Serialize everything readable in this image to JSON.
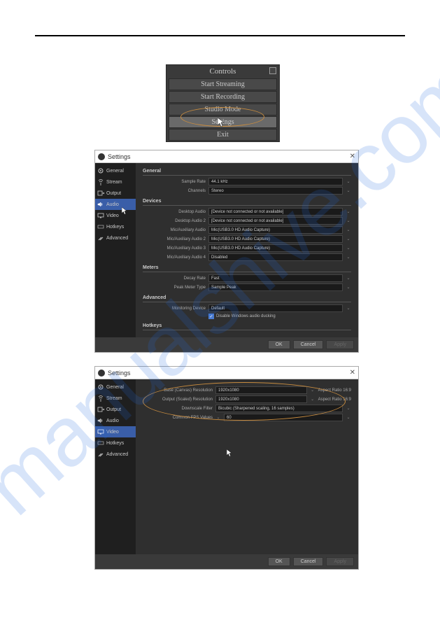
{
  "watermark": "manualshive.com",
  "controls": {
    "title": "Controls",
    "items": [
      "Start Streaming",
      "Start Recording",
      "Studio Mode",
      "Settings",
      "Exit"
    ],
    "highlighted_index": 3
  },
  "settings1": {
    "window_title": "Settings",
    "sidebar": [
      {
        "icon": "gear",
        "label": "General"
      },
      {
        "icon": "antenna",
        "label": "Stream"
      },
      {
        "icon": "out",
        "label": "Output"
      },
      {
        "icon": "speaker",
        "label": "Audio"
      },
      {
        "icon": "monitor",
        "label": "Video"
      },
      {
        "icon": "keyboard",
        "label": "Hotkeys"
      },
      {
        "icon": "tools",
        "label": "Advanced"
      }
    ],
    "sidebar_selected": 3,
    "sections": {
      "general": {
        "title": "General",
        "rows": [
          {
            "label": "Sample Rate",
            "value": "44.1 kHz"
          },
          {
            "label": "Channels",
            "value": "Stereo"
          }
        ]
      },
      "devices": {
        "title": "Devices",
        "rows": [
          {
            "label": "Desktop Audio",
            "value": "[Device not connected or not available]"
          },
          {
            "label": "Desktop Audio 2",
            "value": "[Device not connected or not available]"
          },
          {
            "label": "Mic/Auxiliary Audio",
            "value": "Mic(USB3.0 HD Audio Capture)"
          },
          {
            "label": "Mic/Auxiliary Audio 2",
            "value": "Mic(USB3.0 HD Audio Capture)"
          },
          {
            "label": "Mic/Auxiliary Audio 3",
            "value": "Mic(USB3.0 HD Audio Capture)"
          },
          {
            "label": "Mic/Auxiliary Audio 4",
            "value": "Disabled"
          }
        ]
      },
      "meters": {
        "title": "Meters",
        "rows": [
          {
            "label": "Decay Rate",
            "value": "Fast"
          },
          {
            "label": "Peak Meter Type",
            "value": "Sample Peak"
          }
        ]
      },
      "advanced": {
        "title": "Advanced",
        "rows": [
          {
            "label": "Monitoring Device",
            "value": "Default"
          }
        ],
        "checkbox": "Disable Windows audio ducking"
      },
      "hotkeys": {
        "title": "Hotkeys"
      }
    },
    "buttons": {
      "ok": "OK",
      "cancel": "Cancel",
      "apply": "Apply"
    }
  },
  "settings2": {
    "window_title": "Settings",
    "sidebar": [
      {
        "icon": "gear",
        "label": "General"
      },
      {
        "icon": "antenna",
        "label": "Stream"
      },
      {
        "icon": "out",
        "label": "Output"
      },
      {
        "icon": "speaker",
        "label": "Audio"
      },
      {
        "icon": "monitor",
        "label": "Video"
      },
      {
        "icon": "keyboard",
        "label": "Hotkeys"
      },
      {
        "icon": "tools",
        "label": "Advanced"
      }
    ],
    "sidebar_selected": 4,
    "rows": [
      {
        "label": "Base (Canvas) Resolution",
        "value": "1920x1080",
        "aspect": "Aspect Ratio 16:9"
      },
      {
        "label": "Output (Scaled) Resolution",
        "value": "1920x1080",
        "aspect": "Aspect Ratio 16:9"
      },
      {
        "label": "Downscale Filter",
        "value": "Bicubic (Sharpened scaling, 16 samples)"
      },
      {
        "label": "Common FPS Values",
        "value": "60"
      }
    ],
    "buttons": {
      "ok": "OK",
      "cancel": "Cancel",
      "apply": "Apply"
    }
  }
}
